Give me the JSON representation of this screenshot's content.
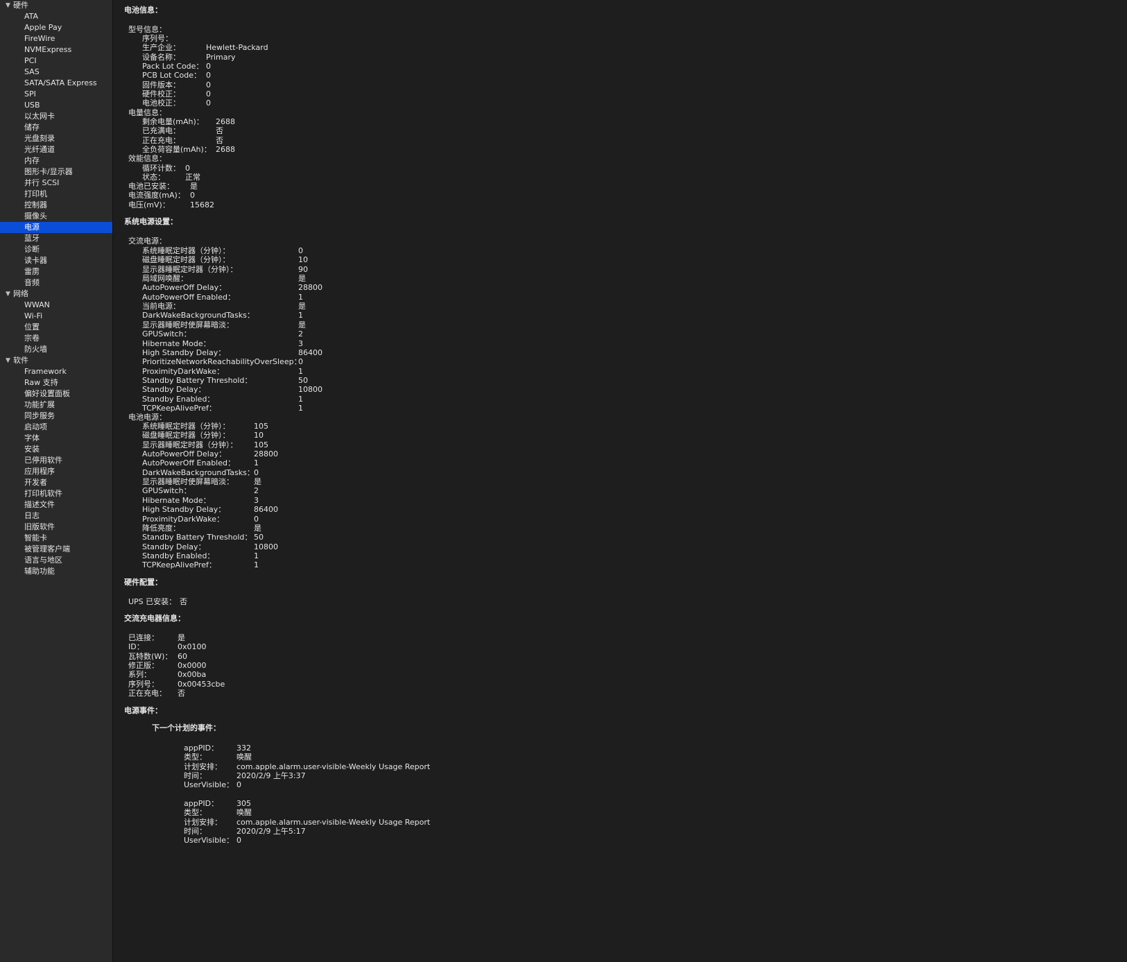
{
  "sidebar": {
    "categories": [
      {
        "label": "硬件",
        "items": [
          "ATA",
          "Apple Pay",
          "FireWire",
          "NVMExpress",
          "PCI",
          "SAS",
          "SATA/SATA Express",
          "SPI",
          "USB",
          "以太网卡",
          "储存",
          "光盘刻录",
          "光纤通道",
          "内存",
          "图形卡/显示器",
          "并行 SCSI",
          "打印机",
          "控制器",
          "摄像头",
          "电源",
          "蓝牙",
          "诊断",
          "读卡器",
          "雷雳",
          "音频"
        ]
      },
      {
        "label": "网络",
        "items": [
          "WWAN",
          "Wi-Fi",
          "位置",
          "宗卷",
          "防火墙"
        ]
      },
      {
        "label": "软件",
        "items": [
          "Framework",
          "Raw 支持",
          "偏好设置面板",
          "功能扩展",
          "同步服务",
          "启动项",
          "字体",
          "安装",
          "已停用软件",
          "应用程序",
          "开发者",
          "打印机软件",
          "描述文件",
          "日志",
          "旧版软件",
          "智能卡",
          "被管理客户端",
          "语言与地区",
          "辅助功能"
        ]
      }
    ],
    "selected": "电源"
  },
  "content": {
    "battery": {
      "title": "电池信息：",
      "model_title": "型号信息：",
      "model": [
        {
          "k": "序列号：",
          "v": ""
        },
        {
          "k": "生产企业：",
          "v": "Hewlett-Packard"
        },
        {
          "k": "设备名称：",
          "v": "Primary"
        },
        {
          "k": "Pack Lot Code：",
          "v": "0"
        },
        {
          "k": "PCB Lot Code：",
          "v": "0"
        },
        {
          "k": "固件版本：",
          "v": "0"
        },
        {
          "k": "硬件校正：",
          "v": "0"
        },
        {
          "k": "电池校正：",
          "v": "0"
        }
      ],
      "charge_title": "电量信息：",
      "charge": [
        {
          "k": "剩余电量(mAh)：",
          "v": "2688"
        },
        {
          "k": "已充满电：",
          "v": "否"
        },
        {
          "k": "正在充电：",
          "v": "否"
        },
        {
          "k": "全负荷容量(mAh)：",
          "v": "2688"
        }
      ],
      "health_title": "效能信息：",
      "health": [
        {
          "k": "循环计数：",
          "v": "0"
        },
        {
          "k": "状态：",
          "v": "正常"
        }
      ],
      "misc": [
        {
          "k": "电池已安装：",
          "v": "是"
        },
        {
          "k": "电流强度(mA)：",
          "v": "0"
        },
        {
          "k": "电压(mV)：",
          "v": "15682"
        }
      ]
    },
    "power_settings": {
      "title": "系统电源设置：",
      "ac_title": "交流电源：",
      "ac": [
        {
          "k": "系统睡眠定时器（分钟）：",
          "v": "0"
        },
        {
          "k": "磁盘睡眠定时器（分钟）：",
          "v": "10"
        },
        {
          "k": "显示器睡眠定时器（分钟）：",
          "v": "90"
        },
        {
          "k": "局域网唤醒：",
          "v": "是"
        },
        {
          "k": "AutoPowerOff Delay：",
          "v": "28800"
        },
        {
          "k": "AutoPowerOff Enabled：",
          "v": "1"
        },
        {
          "k": "当前电源：",
          "v": "是"
        },
        {
          "k": "DarkWakeBackgroundTasks：",
          "v": "1"
        },
        {
          "k": "显示器睡眠时使屏幕暗淡：",
          "v": "是"
        },
        {
          "k": "GPUSwitch：",
          "v": "2"
        },
        {
          "k": "Hibernate Mode：",
          "v": "3"
        },
        {
          "k": "High Standby Delay：",
          "v": "86400"
        },
        {
          "k": "PrioritizeNetworkReachabilityOverSleep：",
          "v": "0"
        },
        {
          "k": "ProximityDarkWake：",
          "v": "1"
        },
        {
          "k": "Standby Battery Threshold：",
          "v": "50"
        },
        {
          "k": "Standby Delay：",
          "v": "10800"
        },
        {
          "k": "Standby Enabled：",
          "v": "1"
        },
        {
          "k": "TCPKeepAlivePref：",
          "v": "1"
        }
      ],
      "batt_title": "电池电源：",
      "batt": [
        {
          "k": "系统睡眠定时器（分钟）：",
          "v": "105"
        },
        {
          "k": "磁盘睡眠定时器（分钟）：",
          "v": "10"
        },
        {
          "k": "显示器睡眠定时器（分钟）：",
          "v": "105"
        },
        {
          "k": "AutoPowerOff Delay：",
          "v": "28800"
        },
        {
          "k": "AutoPowerOff Enabled：",
          "v": "1"
        },
        {
          "k": "DarkWakeBackgroundTasks：",
          "v": "0"
        },
        {
          "k": "显示器睡眠时使屏幕暗淡：",
          "v": "是"
        },
        {
          "k": "GPUSwitch：",
          "v": "2"
        },
        {
          "k": "Hibernate Mode：",
          "v": "3"
        },
        {
          "k": "High Standby Delay：",
          "v": "86400"
        },
        {
          "k": "ProximityDarkWake：",
          "v": "0"
        },
        {
          "k": "降低亮度：",
          "v": "是"
        },
        {
          "k": "Standby Battery Threshold：",
          "v": "50"
        },
        {
          "k": "Standby Delay：",
          "v": "10800"
        },
        {
          "k": "Standby Enabled：",
          "v": "1"
        },
        {
          "k": "TCPKeepAlivePref：",
          "v": "1"
        }
      ]
    },
    "hardware_config": {
      "title": "硬件配置：",
      "rows": [
        {
          "k": "UPS 已安装：",
          "v": "否"
        }
      ]
    },
    "ac_charger": {
      "title": "交流充电器信息：",
      "rows": [
        {
          "k": "已连接：",
          "v": "是"
        },
        {
          "k": "ID：",
          "v": "0x0100"
        },
        {
          "k": "瓦特数(W)：",
          "v": "60"
        },
        {
          "k": "修正版：",
          "v": "0x0000"
        },
        {
          "k": "系列：",
          "v": "0x00ba"
        },
        {
          "k": "序列号：",
          "v": "0x00453cbe"
        },
        {
          "k": "正在充电：",
          "v": "否"
        }
      ]
    },
    "power_events": {
      "title": "电源事件：",
      "next_title": "下一个计划的事件：",
      "events": [
        [
          {
            "k": "appPID：",
            "v": "332"
          },
          {
            "k": "类型：",
            "v": "唤醒"
          },
          {
            "k": "计划安排：",
            "v": "com.apple.alarm.user-visible-Weekly Usage Report"
          },
          {
            "k": "时间：",
            "v": "2020/2/9 上午3:37"
          },
          {
            "k": "UserVisible：",
            "v": "0"
          }
        ],
        [
          {
            "k": "appPID：",
            "v": "305"
          },
          {
            "k": "类型：",
            "v": "唤醒"
          },
          {
            "k": "计划安排：",
            "v": "com.apple.alarm.user-visible-Weekly Usage Report"
          },
          {
            "k": "时间：",
            "v": "2020/2/9 上午5:17"
          },
          {
            "k": "UserVisible：",
            "v": "0"
          }
        ]
      ]
    }
  }
}
